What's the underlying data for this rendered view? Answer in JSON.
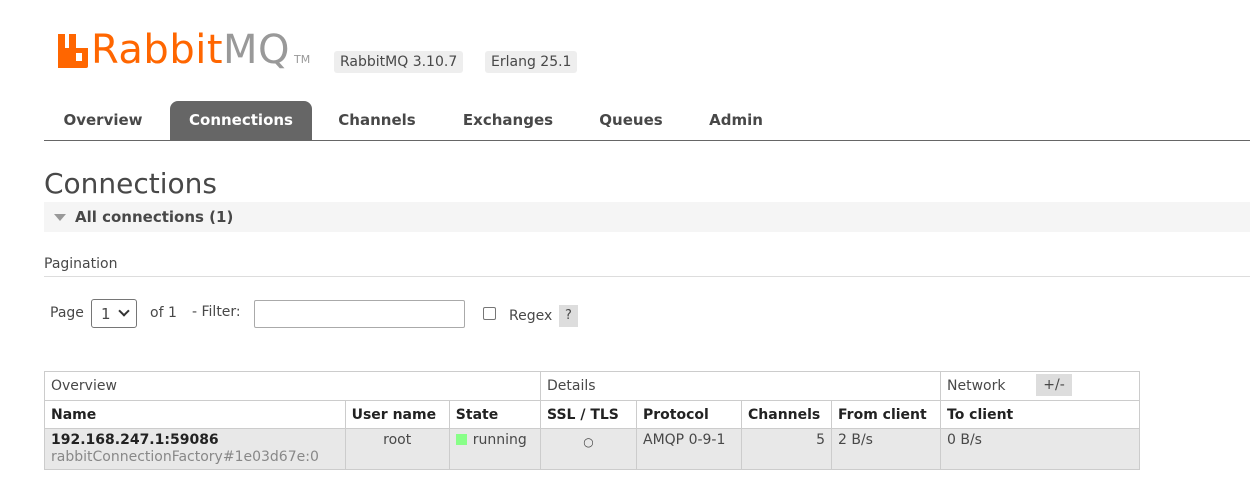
{
  "header": {
    "logo_rabbit": "Rabbit",
    "logo_mq": "MQ",
    "logo_tm": "TM",
    "version_rabbitmq": "RabbitMQ 3.10.7",
    "version_erlang": "Erlang 25.1",
    "brand_color": "#ff6600"
  },
  "tabs": [
    {
      "label": "Overview",
      "active": false
    },
    {
      "label": "Connections",
      "active": true
    },
    {
      "label": "Channels",
      "active": false
    },
    {
      "label": "Exchanges",
      "active": false
    },
    {
      "label": "Queues",
      "active": false
    },
    {
      "label": "Admin",
      "active": false
    }
  ],
  "page_title": "Connections",
  "section": {
    "title": "All connections (1)"
  },
  "pagination": {
    "label": "Pagination",
    "page_label": "Page",
    "page_value": "1",
    "of_label": "of 1",
    "filter_label": "- Filter:",
    "filter_value": "",
    "regex_label": "Regex",
    "regex_checked": false,
    "help_label": "?"
  },
  "table": {
    "groups": [
      "Overview",
      "Details",
      "Network"
    ],
    "columns": [
      "Name",
      "User name",
      "State",
      "SSL / TLS",
      "Protocol",
      "Channels",
      "From client",
      "To client"
    ],
    "rows": [
      {
        "name": "192.168.247.1:59086",
        "name_sub": "rabbitConnectionFactory#1e03d67e:0",
        "user": "root",
        "state": "running",
        "state_color": "#88ff88",
        "ssl": "○",
        "protocol": "AMQP 0-9-1",
        "channels": "5",
        "from_client": "2 B/s",
        "to_client": "0 B/s"
      }
    ],
    "toggle_label": "+/-"
  }
}
